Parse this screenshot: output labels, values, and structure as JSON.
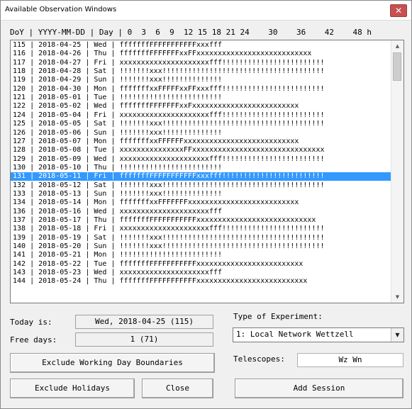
{
  "window": {
    "title": "Available Observation Windows",
    "close_glyph": "✕"
  },
  "list": {
    "header": "DoY | YYYY-MM-DD | Day | 0  3  6  9  12 15 18 21 24    30    36    42    48 h",
    "rows": [
      "115 | 2018-04-25 | Wed | fffffffFFFFFFFFFFFxxxfff",
      "116 | 2018-04-26 | Thu | fffffffFFFFFFFxxFFxxxxxxxxxxxxxxxxxxxxxxxxxxx",
      "117 | 2018-04-27 | Fri | xxxxxxxxxxxxxxxxxxxxxfff!!!!!!!!!!!!!!!!!!!!!!!!",
      "118 | 2018-04-28 | Sat | !!!!!!!xxx!!!!!!!!!!!!!!!!!!!!!!!!!!!!!!!!!!!!!!",
      "119 | 2018-04-29 | Sun | !!!!!!!xxx!!!!!!!!!!!!!!",
      "120 | 2018-04-30 | Mon | fffffffxxFFFFFxxFFxxxfff!!!!!!!!!!!!!!!!!!!!!!!!",
      "121 | 2018-05-01 | Tue | !!!!!!!!!!!!!!!!!!!!!!!!",
      "122 | 2018-05-02 | Wed | fffffffFFFFFFFxxFxxxxxxxxxxxxxxxxxxxxxxxxx",
      "124 | 2018-05-04 | Fri | xxxxxxxxxxxxxxxxxxxxxfff!!!!!!!!!!!!!!!!!!!!!!!!",
      "125 | 2018-05-05 | Sat | !!!!!!!xxx!!!!!!!!!!!!!!!!!!!!!!!!!!!!!!!!!!!!!!",
      "126 | 2018-05-06 | Sun | !!!!!!!xxx!!!!!!!!!!!!!!",
      "127 | 2018-05-07 | Mon | fffffffxxFFFFFFxxxxxxxxxxxxxxxxxxxxxxxxxxx",
      "128 | 2018-05-08 | Tue | xxxxxxxxxxxxxxxFFxxxxxxxxxxxxxxxxxxxxxxxxxxxxxxx",
      "129 | 2018-05-09 | Wed | xxxxxxxxxxxxxxxxxxxxxfff!!!!!!!!!!!!!!!!!!!!!!!!",
      "130 | 2018-05-10 | Thu | !!!!!!!!!!!!!!!!!!!!!!!!",
      "131 | 2018-05-11 | Fri | fffffffFFFFFFFFFFFxxxfff!!!!!!!!!!!!!!!!!!!!!!!!",
      "132 | 2018-05-12 | Sat | !!!!!!!xxx!!!!!!!!!!!!!!!!!!!!!!!!!!!!!!!!!!!!!!",
      "133 | 2018-05-13 | Sun | !!!!!!!xxx!!!!!!!!!!!!!!",
      "134 | 2018-05-14 | Mon | fffffffxxFFFFFFFxxxxxxxxxxxxxxxxxxxxxxxxxx",
      "136 | 2018-05-16 | Wed | xxxxxxxxxxxxxxxxxxxxxfff",
      "137 | 2018-05-17 | Thu | fffffffFFFFFFFFFFFxxxxxxxxxxxxxxxxxxxxxxxxxxxx",
      "138 | 2018-05-18 | Fri | xxxxxxxxxxxxxxxxxxxxxfff!!!!!!!!!!!!!!!!!!!!!!!!",
      "139 | 2018-05-19 | Sat | !!!!!!!xxx!!!!!!!!!!!!!!!!!!!!!!!!!!!!!!!!!!!!!!",
      "140 | 2018-05-20 | Sun | !!!!!!!xxx!!!!!!!!!!!!!!!!!!!!!!!!!!!!!!!!!!!!!!",
      "141 | 2018-05-21 | Mon | !!!!!!!!!!!!!!!!!!!!!!!!",
      "142 | 2018-05-22 | Tue | fffffffFFFFFFFFFFFxxxxxxxxxxxxxxxxxxxxxxxxx",
      "143 | 2018-05-23 | Wed | xxxxxxxxxxxxxxxxxxxxxfff",
      "144 | 2018-05-24 | Thu | fffffffFFFFFFFFFFFxxxxxxxxxxxxxxxxxxxxxxxxxx"
    ],
    "selected_row": 15,
    "scroll_up_glyph": "▲",
    "scroll_down_glyph": "▼"
  },
  "today": {
    "label": "Today is:",
    "value": "Wed, 2018-04-25 (115)"
  },
  "free_days": {
    "label": "Free days:",
    "value": "1 (71)"
  },
  "experiment": {
    "label": "Type of Experiment:",
    "selected": "1: Local Network Wettzell",
    "dropdown_glyph": "▼"
  },
  "telescopes": {
    "label": "Telescopes:",
    "value": "Wz Wn"
  },
  "buttons": {
    "exclude_boundaries": "Exclude Working Day Boundaries",
    "exclude_holidays": "Exclude Holidays",
    "close": "Close",
    "add_session": "Add Session"
  },
  "colors": {
    "selection": "#3399ff",
    "close_button": "#c75050"
  }
}
